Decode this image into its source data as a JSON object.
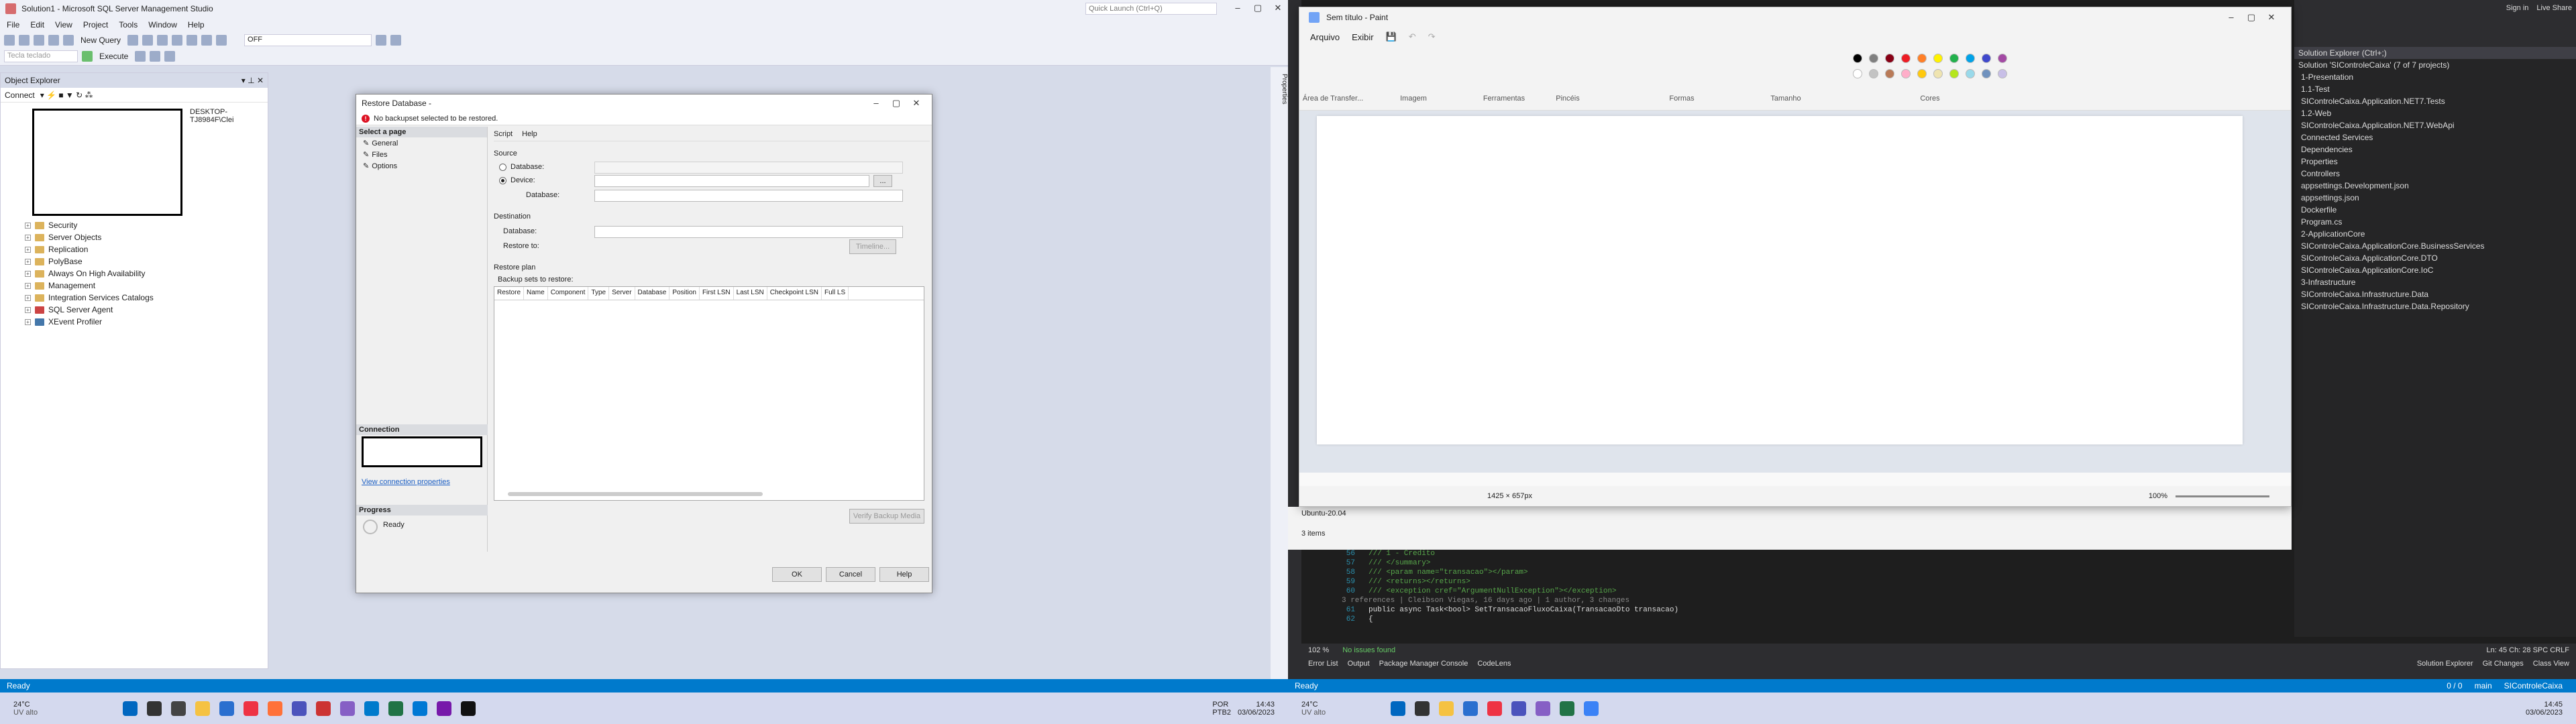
{
  "ssms": {
    "title": "Solution1 - Microsoft SQL Server Management Studio",
    "quick_launch": "Quick Launch (Ctrl+Q)",
    "menu": [
      "File",
      "Edit",
      "View",
      "Project",
      "Tools",
      "Window",
      "Help"
    ],
    "toolbar": {
      "new_query": "New Query",
      "execute": "Execute",
      "db_combo": "OFF",
      "small_combo": "Tecla teclado"
    },
    "object_explorer": {
      "title": "Object Explorer",
      "connect": "Connect",
      "server": "DESKTOP-TJ8984F\\Clei",
      "nodes": [
        "Security",
        "Server Objects",
        "Replication",
        "PolyBase",
        "Always On High Availability",
        "Management",
        "Integration Services Catalogs",
        "SQL Server Agent",
        "XEvent Profiler"
      ]
    },
    "status": "Ready"
  },
  "restore": {
    "title": "Restore Database -",
    "error": "No backupset selected to be restored.",
    "select_page": "Select a page",
    "pages": [
      "General",
      "Files",
      "Options"
    ],
    "script": "Script",
    "help_link": "Help",
    "source": "Source",
    "database": "Database:",
    "device": "Device:",
    "device_db": "Database:",
    "destination": "Destination",
    "dest_db": "Database:",
    "restore_to": "Restore to:",
    "timeline": "Timeline...",
    "restore_plan": "Restore plan",
    "backup_sets": "Backup sets to restore:",
    "columns": [
      "Restore",
      "Name",
      "Component",
      "Type",
      "Server",
      "Database",
      "Position",
      "First LSN",
      "Last LSN",
      "Checkpoint LSN",
      "Full LS"
    ],
    "verify": "Verify Backup Media",
    "connection": "Connection",
    "view_conn": "View connection properties",
    "progress": "Progress",
    "ready": "Ready",
    "ok": "OK",
    "cancel": "Cancel",
    "help": "Help"
  },
  "paint": {
    "title": "Sem título - Paint",
    "menu": [
      "Arquivo",
      "Exibir"
    ],
    "groups": [
      "Área de Transfer...",
      "Imagem",
      "Ferramentas",
      "Pincéis",
      "Formas",
      "Tamanho",
      "Cores"
    ],
    "canvas_size": "1425 × 657px",
    "zoom": "100%",
    "colors": [
      "#000000",
      "#7f7f7f",
      "#880015",
      "#ed1c24",
      "#ff7f27",
      "#fff200",
      "#22b14c",
      "#00a2e8",
      "#3f48cc",
      "#a349a4",
      "#ffffff",
      "#c3c3c3",
      "#b97a57",
      "#ffaec9",
      "#ffc90e",
      "#efe4b0",
      "#b5e61d",
      "#99d9ea",
      "#7092be",
      "#c8bfe7"
    ]
  },
  "vs": {
    "solution": "Solution Explorer",
    "search": "Solution Explorer (Ctrl+;)",
    "sol_title": "Solution 'SIControleCaixa' (7 of 7 projects)",
    "tree": [
      "1-Presentation",
      "1.1-Test",
      "SIControleCaixa.Application.NET7.Tests",
      "1.2-Web",
      "SIControleCaixa.Application.NET7.WebApi",
      "Connected Services",
      "Dependencies",
      "Properties",
      "Controllers",
      "appsettings.Development.json",
      "appsettings.json",
      "Dockerfile",
      "Program.cs",
      "2-ApplicationCore",
      "SIControleCaixa.ApplicationCore.BusinessServices",
      "SIControleCaixa.ApplicationCore.DTO",
      "SIControleCaixa.ApplicationCore.IoC",
      "3-Infrastructure",
      "SIControleCaixa.Infrastructure.Data",
      "SIControleCaixa.Infrastructure.Data.Repository"
    ],
    "code": [
      {
        "n": "56",
        "t": "/// 1 - Credito"
      },
      {
        "n": "57",
        "t": "/// </summary>"
      },
      {
        "n": "58",
        "t": "/// <param name=\"transacao\"></param>"
      },
      {
        "n": "59",
        "t": "/// <returns></returns>"
      },
      {
        "n": "60",
        "t": "/// <exception cref=\"ArgumentNullException\"></exception>"
      },
      {
        "n": "61",
        "t": "public async Task<bool> SetTransacaoFluxoCaixa(TransacaoDto transacao)"
      },
      {
        "n": "62",
        "t": "{"
      }
    ],
    "codelens": "3 references | Cleibson Viegas, 16 days ago | 1 author, 3 changes",
    "zoom": "102 %",
    "issues": "No issues found",
    "position": "Ln: 45   Ch: 28   SPC   CRLF",
    "tabs": [
      "Error List",
      "Output",
      "Package Manager Console",
      "CodeLens"
    ],
    "bottom_tabs": [
      "Solution Explorer",
      "Git Changes",
      "Class View"
    ],
    "branch": "main",
    "repo": "SIControleCaixa",
    "sync": "0 / 0",
    "status": "Ready",
    "items": "3 items",
    "ubuntu": "Ubuntu-20.04",
    "sign_in": "Sign in",
    "live_share": "Live Share"
  },
  "taskbar": {
    "weather_temp": "24°C",
    "weather_desc": "UV alto",
    "lang": "POR",
    "kb": "PTB2",
    "time": "14:43",
    "date": "03/06/2023",
    "time_r": "14:45",
    "date_r": "03/06/2023"
  }
}
